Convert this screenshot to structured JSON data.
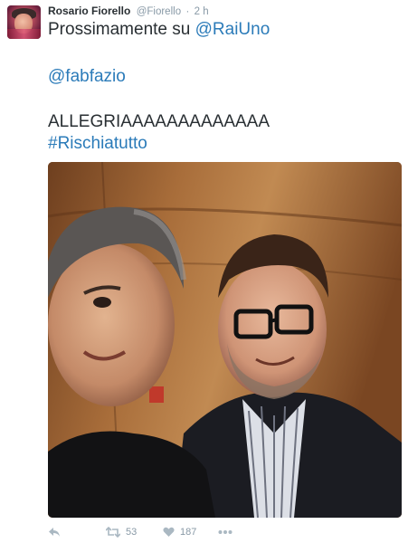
{
  "tweet": {
    "author": {
      "fullname": "Rosario Fiorello",
      "username": "@Fiorello",
      "separator": "·",
      "time": "2 h"
    },
    "text": {
      "line1_prefix": "Prossimamente su ",
      "line1_mention": "@RaiUno",
      "line2_mention": "@fabfazio",
      "line3": "ALLEGRIAAAAAAAAAAAAA",
      "line4_hashtag": "#Rischiatutto"
    },
    "actions": {
      "retweet_count": "53",
      "like_count": "187"
    },
    "icons": {
      "reply": "reply-icon",
      "retweet": "retweet-icon",
      "like": "heart-icon",
      "more": "more-icon"
    },
    "colors": {
      "link": "#2b7bb9",
      "meta": "#8899a6",
      "icon": "#aab8c2",
      "text": "#292f33"
    }
  }
}
